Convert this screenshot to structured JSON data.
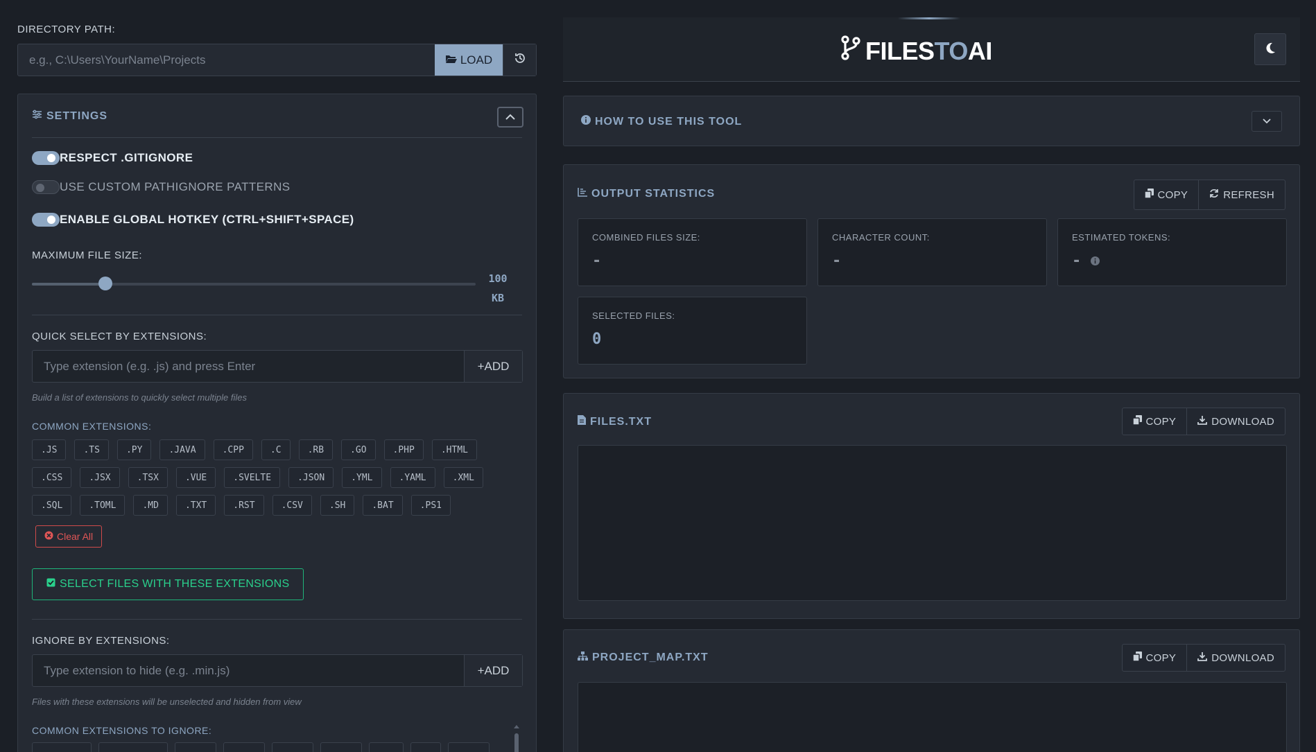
{
  "directory": {
    "label": "DIRECTORY PATH:",
    "placeholder": "e.g., C:\\Users\\YourName\\Projects",
    "load_label": "LOAD"
  },
  "settings": {
    "title": "SETTINGS",
    "toggles": [
      {
        "label": "RESPECT .GITIGNORE",
        "on": true
      },
      {
        "label": "USE CUSTOM PATHIGNORE PATTERNS",
        "on": false
      },
      {
        "label": "ENABLE GLOBAL HOTKEY (CTRL+SHIFT+SPACE)",
        "on": true
      }
    ],
    "max_file_size": {
      "label": "MAXIMUM FILE SIZE:",
      "value": "100",
      "unit": "KB",
      "fraction": 0.165
    },
    "quick_select": {
      "label": "QUICK SELECT BY EXTENSIONS:",
      "placeholder": "Type extension (e.g. .js) and press Enter",
      "add_label": "ADD",
      "hint": "Build a list of extensions to quickly select multiple files",
      "common_label": "COMMON EXTENSIONS:",
      "extensions": [
        ".JS",
        ".TS",
        ".PY",
        ".JAVA",
        ".CPP",
        ".C",
        ".RB",
        ".GO",
        ".PHP",
        ".HTML",
        ".CSS",
        ".JSX",
        ".TSX",
        ".VUE",
        ".SVELTE",
        ".JSON",
        ".YML",
        ".YAML",
        ".XML",
        ".SQL",
        ".TOML",
        ".MD",
        ".TXT",
        ".RST",
        ".CSV",
        ".SH",
        ".BAT",
        ".PS1"
      ],
      "clear_label": "Clear All",
      "select_label": "SELECT FILES WITH THESE EXTENSIONS"
    },
    "ignore": {
      "label": "IGNORE BY EXTENSIONS:",
      "placeholder": "Type extension to hide (e.g. .min.js)",
      "add_label": "ADD",
      "hint": "Files with these extensions will be unselected and hidden from view",
      "common_label": "COMMON EXTENSIONS TO IGNORE:"
    }
  },
  "header": {
    "brand_a": "FILES",
    "brand_b": "TO",
    "brand_c": "AI"
  },
  "how_to": {
    "title": "HOW TO USE THIS TOOL"
  },
  "stats": {
    "title": "OUTPUT STATISTICS",
    "copy_label": "COPY",
    "refresh_label": "REFRESH",
    "items": [
      {
        "label": "COMBINED FILES SIZE:",
        "value": "-"
      },
      {
        "label": "CHARACTER COUNT:",
        "value": "-"
      },
      {
        "label": "ESTIMATED TOKENS:",
        "value": "-"
      },
      {
        "label": "SELECTED FILES:",
        "value": "0"
      }
    ]
  },
  "files_txt": {
    "title": "FILES.TXT",
    "copy_label": "COPY",
    "download_label": "DOWNLOAD"
  },
  "project_map": {
    "title": "PROJECT_MAP.TXT",
    "copy_label": "COPY",
    "download_label": "DOWNLOAD"
  },
  "colors": {
    "accent": "#8ea7c3",
    "background": "#1b1f26",
    "panel": "#252a33",
    "danger": "#e05656",
    "success": "#2ad08c"
  }
}
